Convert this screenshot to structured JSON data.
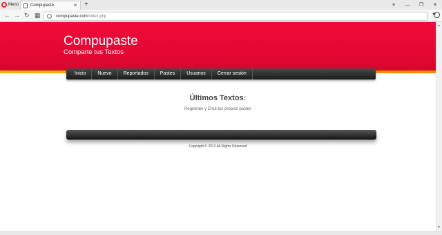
{
  "browser": {
    "menu_label": "Menú",
    "tab_title": "Compupaste",
    "url_host": "compupaste.com",
    "url_path": "/index.php"
  },
  "site": {
    "title": "Compupaste",
    "subtitle": "Comparte tus Textos",
    "nav": [
      "Inicio",
      "Nuevo",
      "Reportados",
      "Pastes",
      "Usuarios",
      "Cerrar sesión"
    ],
    "section_title": "Últimos Textos:",
    "section_text": "Registrate y Crea tus propios pastes",
    "copyright": "Copyright © 2012 All Rights Reserved"
  },
  "colors": {
    "header_red": "#e20832",
    "header_stripe": "#f4b400",
    "navbar_dark": "#1b1b1b"
  }
}
